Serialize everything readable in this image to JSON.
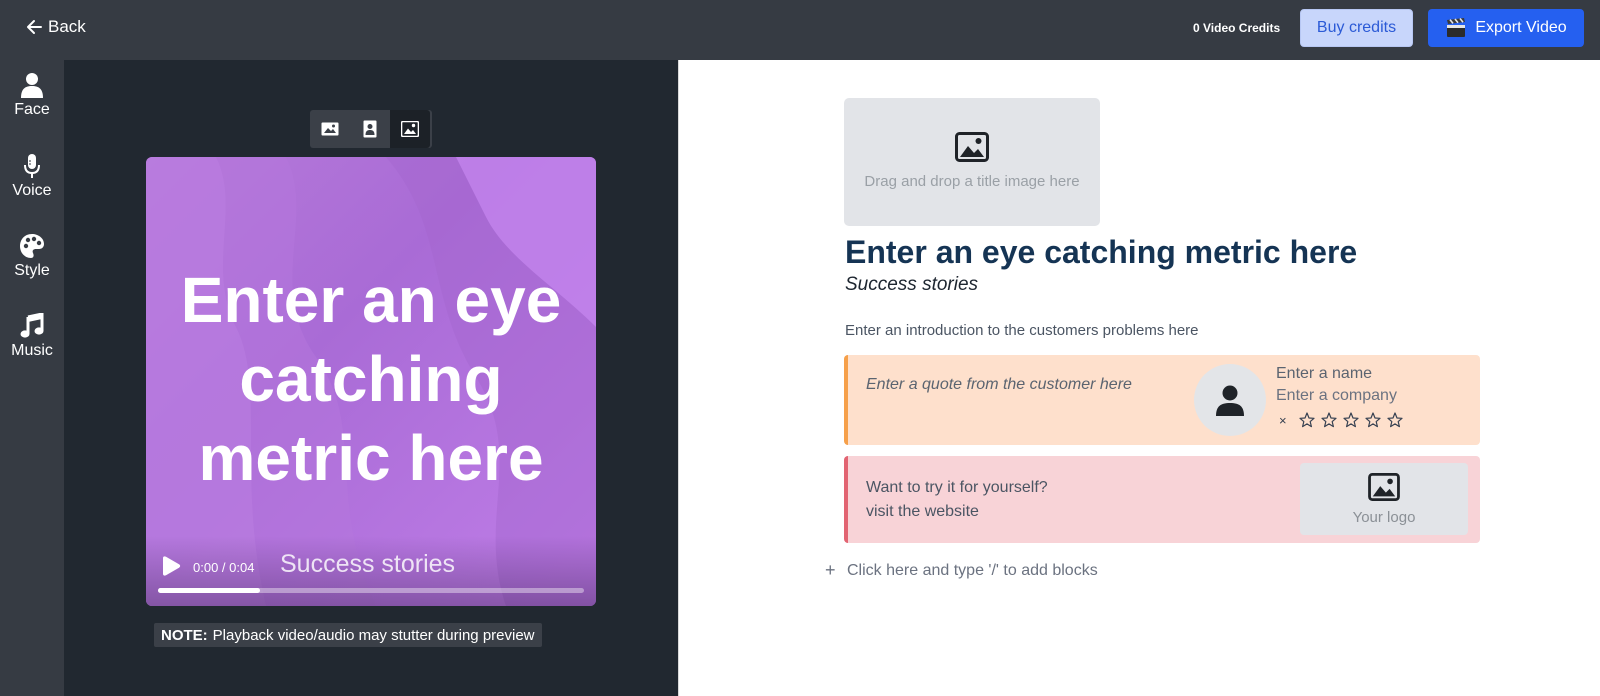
{
  "topbar": {
    "back_label": "Back",
    "credits": "0 Video Credits",
    "buy_label": "Buy credits",
    "export_label": "Export Video"
  },
  "rail": {
    "items": [
      {
        "label": "Face",
        "icon": "user-icon"
      },
      {
        "label": "Voice",
        "icon": "microphone-icon"
      },
      {
        "label": "Style",
        "icon": "palette-icon"
      },
      {
        "label": "Music",
        "icon": "music-note-icon"
      }
    ]
  },
  "preview": {
    "title": "Enter an eye catching metric here",
    "subtitle": "Success stories",
    "time": "0:00 / 0:04",
    "progress": 0.24,
    "note_bold": "NOTE:",
    "note_text": "Playback video/audio may stutter during preview",
    "modes": [
      "landscape-icon",
      "portrait-icon",
      "square-image-icon"
    ]
  },
  "editor": {
    "title_image_hint": "Drag and drop a title image here",
    "metric": "Enter an eye catching metric here",
    "subtitle": "Success stories",
    "intro": "Enter an introduction to the customers problems here",
    "quote": {
      "text": "Enter a quote from the customer here",
      "name": "Enter a name",
      "company": "Enter a company",
      "clear": "×",
      "rating": 0,
      "max_rating": 5
    },
    "cta": {
      "line1": "Want to try it for yourself?",
      "line2": "visit the website",
      "logo_label": "Your logo"
    },
    "add_block": "Click here and type '/' to add blocks"
  },
  "colors": {
    "topbar": "#363b43",
    "preview_bg": "#212830",
    "export": "#2560f0",
    "buy": "#c8d6fb",
    "video": "#b57ad9",
    "quote_bg": "#fee0cc",
    "quote_accent": "#f6a04a",
    "cta_bg": "#f8d3d7",
    "cta_accent": "#e26472",
    "metric_text": "#153454"
  }
}
